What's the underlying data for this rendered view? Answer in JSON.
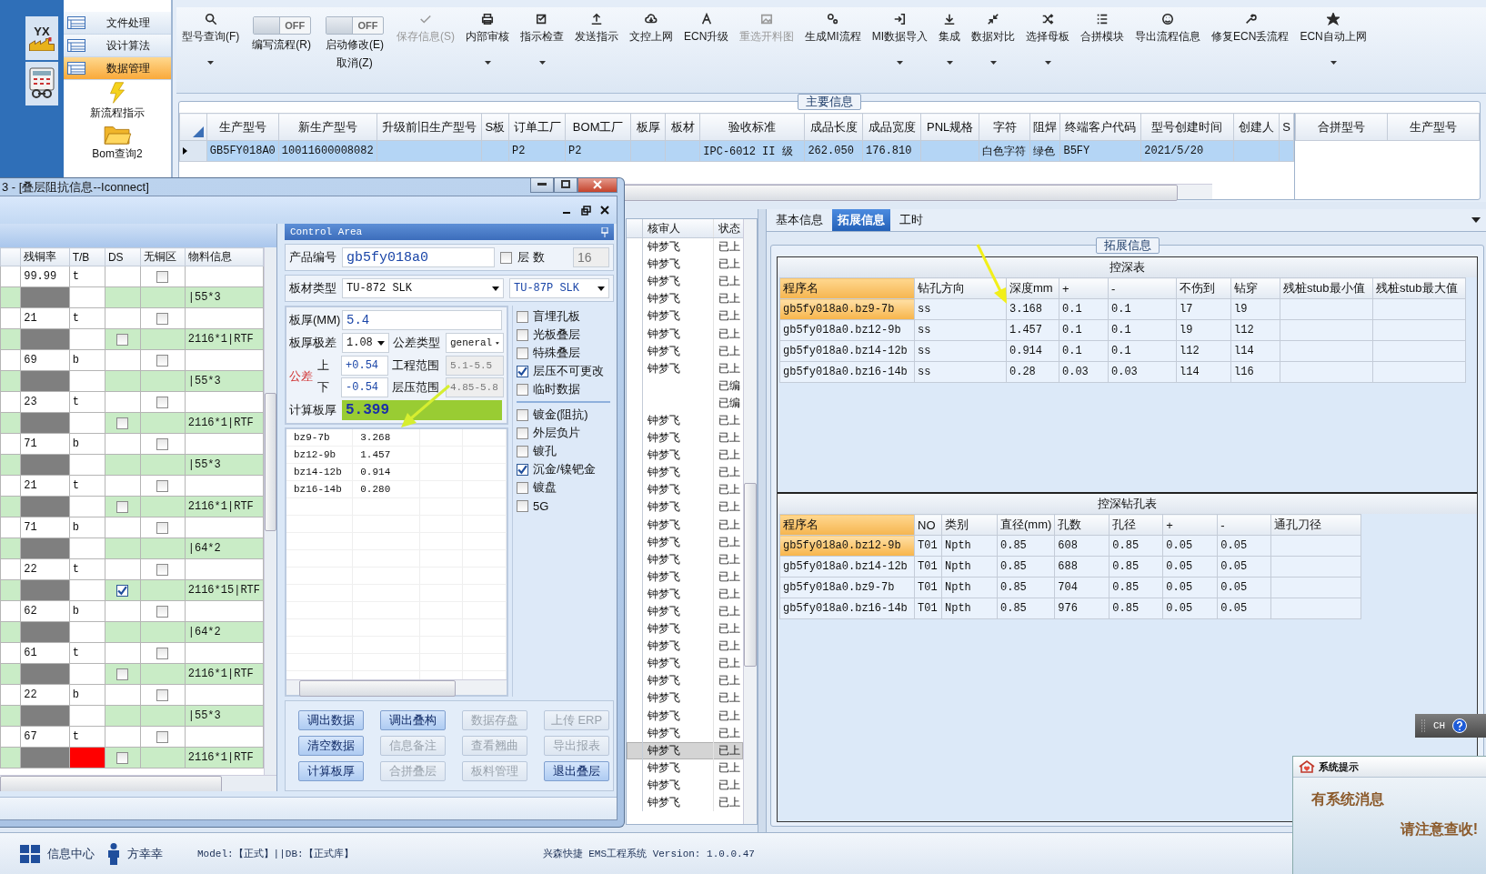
{
  "logo": {
    "text": "YX"
  },
  "nav": {
    "items": [
      {
        "label": "文件处理",
        "selected": false
      },
      {
        "label": "设计算法",
        "selected": false
      },
      {
        "label": "数据管理",
        "selected": true
      }
    ],
    "shortcuts": [
      {
        "kind": "bolt",
        "label": "新流程指示"
      },
      {
        "kind": "folder",
        "label": "Bom查询2"
      }
    ]
  },
  "toolbar": [
    {
      "kind": "button",
      "label": "型号查询(F)",
      "dropdown": true,
      "disabled": false
    },
    {
      "kind": "toggle",
      "switch_text": "OFF",
      "on": false,
      "label": "编写流程(R)"
    },
    {
      "kind": "toggle",
      "switch_text": "OFF",
      "on": false,
      "label": "启动修改(E)",
      "sublabel": "取消(Z)"
    },
    {
      "kind": "button",
      "label": "保存信息(S)",
      "dropdown": false,
      "disabled": true
    },
    {
      "kind": "button",
      "label": "内部审核",
      "dropdown": true,
      "disabled": false
    },
    {
      "kind": "button",
      "label": "指示检查",
      "dropdown": true,
      "disabled": false
    },
    {
      "kind": "button",
      "label": "发送指示",
      "dropdown": false,
      "disabled": false
    },
    {
      "kind": "button",
      "label": "文控上网",
      "dropdown": false,
      "disabled": false
    },
    {
      "kind": "button",
      "label": "ECN升级",
      "dropdown": false,
      "disabled": false
    },
    {
      "kind": "button",
      "label": "重选开料图",
      "dropdown": false,
      "disabled": true
    },
    {
      "kind": "button",
      "label": "生成MI流程",
      "dropdown": false,
      "disabled": false
    },
    {
      "kind": "button",
      "label": "MI数据导入",
      "dropdown": true,
      "disabled": false
    },
    {
      "kind": "button",
      "label": "集成",
      "dropdown": true,
      "disabled": false
    },
    {
      "kind": "button",
      "label": "数据对比",
      "dropdown": true,
      "disabled": false
    },
    {
      "kind": "button",
      "label": "选择母板",
      "dropdown": true,
      "disabled": false
    },
    {
      "kind": "button",
      "label": "合拼模块",
      "dropdown": false,
      "disabled": false
    },
    {
      "kind": "button",
      "label": "导出流程信息",
      "dropdown": false,
      "disabled": false
    },
    {
      "kind": "button",
      "label": "修复ECN丢流程",
      "dropdown": false,
      "disabled": false
    },
    {
      "kind": "button",
      "label": "ECN自动上网",
      "dropdown": true,
      "disabled": false
    }
  ],
  "main_info": {
    "title": "主要信息",
    "columns": [
      "生产型号",
      "新生产型号",
      "升级前旧生产型号",
      "S板",
      "订单工厂",
      "BOM工厂",
      "板厚",
      "板材",
      "验收标准",
      "成品长度",
      "成品宽度",
      "PNL规格",
      "字符",
      "阻焊",
      "终端客户代码",
      "型号创建时间",
      "创建人",
      "S"
    ],
    "rows": [
      {
        "selected": true,
        "cells": [
          "GB5FY018A0",
          "10011600008082",
          null,
          null,
          "P2",
          "P2",
          null,
          null,
          "IPC-6012 II 级",
          "262.050",
          "176.810",
          null,
          "白色字符",
          "绿色",
          "B5FY",
          "2021/5/20",
          null,
          null
        ]
      }
    ]
  },
  "merge_table": {
    "columns": [
      "合拼型号",
      "生产型号"
    ]
  },
  "review_list": {
    "columns": [
      "核审人",
      "状态"
    ],
    "rows": [
      {
        "reviewer": "钟梦飞",
        "status": "已上",
        "selected": false
      },
      {
        "reviewer": "钟梦飞",
        "status": "已上",
        "selected": false
      },
      {
        "reviewer": "钟梦飞",
        "status": "已上",
        "selected": false
      },
      {
        "reviewer": "钟梦飞",
        "status": "已上",
        "selected": false
      },
      {
        "reviewer": "钟梦飞",
        "status": "已上",
        "selected": false
      },
      {
        "reviewer": "钟梦飞",
        "status": "已上",
        "selected": false
      },
      {
        "reviewer": "钟梦飞",
        "status": "已上",
        "selected": false
      },
      {
        "reviewer": "钟梦飞",
        "status": "已上",
        "selected": false
      },
      {
        "status": "已编",
        "selected": false
      },
      {
        "status": "已编",
        "selected": false
      },
      {
        "reviewer": "钟梦飞",
        "status": "已上",
        "selected": false
      },
      {
        "reviewer": "钟梦飞",
        "status": "已上",
        "selected": false
      },
      {
        "reviewer": "钟梦飞",
        "status": "已上",
        "selected": false
      },
      {
        "reviewer": "钟梦飞",
        "status": "已上",
        "selected": false
      },
      {
        "reviewer": "钟梦飞",
        "status": "已上",
        "selected": false
      },
      {
        "reviewer": "钟梦飞",
        "status": "已上",
        "selected": false
      },
      {
        "reviewer": "钟梦飞",
        "status": "已上",
        "selected": false
      },
      {
        "reviewer": "钟梦飞",
        "status": "已上",
        "selected": false
      },
      {
        "reviewer": "钟梦飞",
        "status": "已上",
        "selected": false
      },
      {
        "reviewer": "钟梦飞",
        "status": "已上",
        "selected": false
      },
      {
        "reviewer": "钟梦飞",
        "status": "已上",
        "selected": false
      },
      {
        "reviewer": "钟梦飞",
        "status": "已上",
        "selected": false
      },
      {
        "reviewer": "钟梦飞",
        "status": "已上",
        "selected": false
      },
      {
        "reviewer": "钟梦飞",
        "status": "已上",
        "selected": false
      },
      {
        "reviewer": "钟梦飞",
        "status": "已上",
        "selected": false
      },
      {
        "reviewer": "钟梦飞",
        "status": "已上",
        "selected": false
      },
      {
        "reviewer": "钟梦飞",
        "status": "已上",
        "selected": false
      },
      {
        "reviewer": "钟梦飞",
        "status": "已上",
        "selected": false
      },
      {
        "reviewer": "钟梦飞",
        "status": "已上",
        "selected": false
      },
      {
        "reviewer": "钟梦飞",
        "status": "已上",
        "selected": true
      },
      {
        "reviewer": "钟梦飞",
        "status": "已上",
        "selected": false
      },
      {
        "reviewer": "钟梦飞",
        "status": "已上",
        "selected": false
      },
      {
        "reviewer": "钟梦飞",
        "status": "已上",
        "selected": false
      }
    ]
  },
  "detail": {
    "tabs": [
      {
        "label": "基本信息",
        "selected": false
      },
      {
        "label": "拓展信息",
        "selected": true
      },
      {
        "label": "工时",
        "selected": false
      }
    ],
    "group_title": "拓展信息",
    "depth_table": {
      "title": "控深表",
      "columns": [
        "程序名",
        "钻孔方向",
        "深度mm",
        "+",
        "-",
        "不伤到",
        "钻穿",
        "残桩stub最小值",
        "残桩stub最大值"
      ],
      "rows": [
        {
          "selected": true,
          "cells": [
            "gb5fy018a0.bz9-7b",
            "ss",
            "3.168",
            "0.1",
            "0.1",
            "l7",
            "l9",
            null,
            null
          ]
        },
        {
          "selected": false,
          "cells": [
            "gb5fy018a0.bz12-9b",
            "ss",
            "1.457",
            "0.1",
            "0.1",
            "l9",
            "l12",
            null,
            null
          ]
        },
        {
          "selected": false,
          "cells": [
            "gb5fy018a0.bz14-12b",
            "ss",
            "0.914",
            "0.1",
            "0.1",
            "l12",
            "l14",
            null,
            null
          ]
        },
        {
          "selected": false,
          "cells": [
            "gb5fy018a0.bz16-14b",
            "ss",
            "0.28",
            "0.03",
            "0.03",
            "l14",
            "l16",
            null,
            null
          ]
        }
      ]
    },
    "drill_table": {
      "title": "控深钻孔表",
      "columns": [
        "程序名",
        "NO",
        "类别",
        "直径(mm)",
        "孔数",
        "孔径",
        "+",
        "-",
        "通孔刀径"
      ],
      "rows": [
        {
          "selected": true,
          "cells": [
            "gb5fy018a0.bz12-9b",
            "T01",
            "Npth",
            "0.85",
            "608",
            "0.85",
            "0.05",
            "0.05",
            null
          ]
        },
        {
          "selected": false,
          "cells": [
            "gb5fy018a0.bz14-12b",
            "T01",
            "Npth",
            "0.85",
            "688",
            "0.85",
            "0.05",
            "0.05",
            null
          ]
        },
        {
          "selected": false,
          "cells": [
            "gb5fy018a0.bz9-7b",
            "T01",
            "Npth",
            "0.85",
            "704",
            "0.85",
            "0.05",
            "0.05",
            null
          ]
        },
        {
          "selected": false,
          "cells": [
            "gb5fy018a0.bz16-14b",
            "T01",
            "Npth",
            "0.85",
            "976",
            "0.85",
            "0.05",
            "0.05",
            null
          ]
        }
      ]
    }
  },
  "dialog": {
    "title": "3 - [叠层阻抗信息--Iconnect]",
    "grid": {
      "columns": [
        "残铜率",
        "T/B",
        "DS",
        "无铜区",
        "物料信息"
      ],
      "rows": [
        {
          "kind": "layer",
          "copper": "99.99",
          "side": "t",
          "void_checked": false
        },
        {
          "kind": "material",
          "info": "|55*3",
          "ds_box": false,
          "alert": false
        },
        {
          "kind": "layer",
          "copper": "21",
          "side": "t",
          "void_checked": false
        },
        {
          "kind": "material",
          "info": "2116*1|RTF",
          "ds_box": true,
          "ds_checked": false,
          "alert": false
        },
        {
          "kind": "layer",
          "copper": "69",
          "side": "b",
          "void_checked": false
        },
        {
          "kind": "material",
          "info": "|55*3",
          "ds_box": false,
          "alert": false
        },
        {
          "kind": "layer",
          "copper": "23",
          "side": "t",
          "void_checked": false
        },
        {
          "kind": "material",
          "info": "2116*1|RTF",
          "ds_box": true,
          "ds_checked": false,
          "alert": false
        },
        {
          "kind": "layer",
          "copper": "71",
          "side": "b",
          "void_checked": false
        },
        {
          "kind": "material",
          "info": "|55*3",
          "ds_box": false,
          "alert": false
        },
        {
          "kind": "layer",
          "copper": "21",
          "side": "t",
          "void_checked": false
        },
        {
          "kind": "material",
          "info": "2116*1|RTF",
          "ds_box": true,
          "ds_checked": false,
          "alert": false
        },
        {
          "kind": "layer",
          "copper": "71",
          "side": "b",
          "void_checked": false
        },
        {
          "kind": "material",
          "info": "|64*2",
          "ds_box": false,
          "alert": false
        },
        {
          "kind": "layer",
          "copper": "22",
          "side": "t",
          "void_checked": false
        },
        {
          "kind": "material",
          "info": "2116*15|RTF",
          "ds_box": true,
          "ds_checked": true,
          "alert": false
        },
        {
          "kind": "layer",
          "copper": "62",
          "side": "b",
          "void_checked": false
        },
        {
          "kind": "material",
          "info": "|64*2",
          "ds_box": false,
          "alert": false
        },
        {
          "kind": "layer",
          "copper": "61",
          "side": "t",
          "void_checked": false
        },
        {
          "kind": "material",
          "info": "2116*1|RTF",
          "ds_box": true,
          "ds_checked": false,
          "alert": false
        },
        {
          "kind": "layer",
          "copper": "22",
          "side": "b",
          "void_checked": false
        },
        {
          "kind": "material",
          "info": "|55*3",
          "ds_box": false,
          "alert": false
        },
        {
          "kind": "layer",
          "copper": "67",
          "side": "t",
          "void_checked": false
        },
        {
          "kind": "material",
          "info": "2116*1|RTF",
          "ds_box": true,
          "ds_checked": false,
          "alert": true
        }
      ]
    },
    "control_area": {
      "title": "Control Area",
      "product_label": "产品编号",
      "product_code": "gb5fy018a0",
      "layers_label": "层 数",
      "layers_checked": false,
      "layers": "16",
      "material_label": "板材类型",
      "material": "TU-872 SLK",
      "material2": "TU-87P SLK",
      "thickness_label": "板厚(MM)",
      "thickness": "5.4",
      "range_label": "板厚极差",
      "range": "1.08",
      "tol_type_label": "公差类型",
      "tol_type": "general",
      "tol_label": "公差",
      "upper_label": "上",
      "upper": "+0.54",
      "lower_label": "下",
      "lower": "-0.54",
      "eng_label": "工程范围",
      "eng_range": "5.1-5.5",
      "press_label": "层压范围",
      "press_range": "4.85-5.8",
      "calc_label": "计算板厚",
      "calc": "5.399",
      "options": [
        {
          "label": "盲埋孔板",
          "checked": false
        },
        {
          "label": "光板叠层",
          "checked": false
        },
        {
          "label": "特殊叠层",
          "checked": false
        },
        {
          "label": "层压不可更改",
          "checked": true
        },
        {
          "label": "临时数据",
          "checked": false
        }
      ],
      "options2": [
        {
          "label": "镀金(阻抗)",
          "checked": false
        },
        {
          "label": "外层负片",
          "checked": false
        },
        {
          "label": "镀孔",
          "checked": false
        },
        {
          "label": "沉金/镍钯金",
          "checked": true
        },
        {
          "label": "镀盘",
          "checked": false
        },
        {
          "label": "5G",
          "checked": false
        }
      ],
      "results": [
        {
          "name": "bz9-7b",
          "value": "3.268"
        },
        {
          "name": "bz12-9b",
          "value": "1.457"
        },
        {
          "name": "bz14-12b",
          "value": "0.914"
        },
        {
          "name": "bz16-14b",
          "value": "0.280"
        }
      ]
    },
    "buttons": [
      {
        "label": "调出数据",
        "disabled": false
      },
      {
        "label": "调出叠构",
        "disabled": false
      },
      {
        "label": "数据存盘",
        "disabled": true
      },
      {
        "label": "上传 ERP",
        "disabled": true
      },
      {
        "label": "清空数据",
        "disabled": false
      },
      {
        "label": "信息备注",
        "disabled": true
      },
      {
        "label": "查看翘曲",
        "disabled": true
      },
      {
        "label": "导出报表",
        "disabled": true
      },
      {
        "label": "计算板厚",
        "disabled": false
      },
      {
        "label": "合拼叠层",
        "disabled": true
      },
      {
        "label": "板料管理",
        "disabled": true
      },
      {
        "label": "退出叠层",
        "disabled": false
      }
    ]
  },
  "status_bar": {
    "info_center": "信息中心",
    "user": "方幸幸",
    "model": "Model:【正式】||DB:【正式库】",
    "version": "兴森快捷 EMS工程系统 Version: 1.0.0.47"
  },
  "language_bar": {
    "text": "CH"
  },
  "popup": {
    "title": "系统提示",
    "line1": "有系统消息",
    "line2": "请注意查收!"
  }
}
